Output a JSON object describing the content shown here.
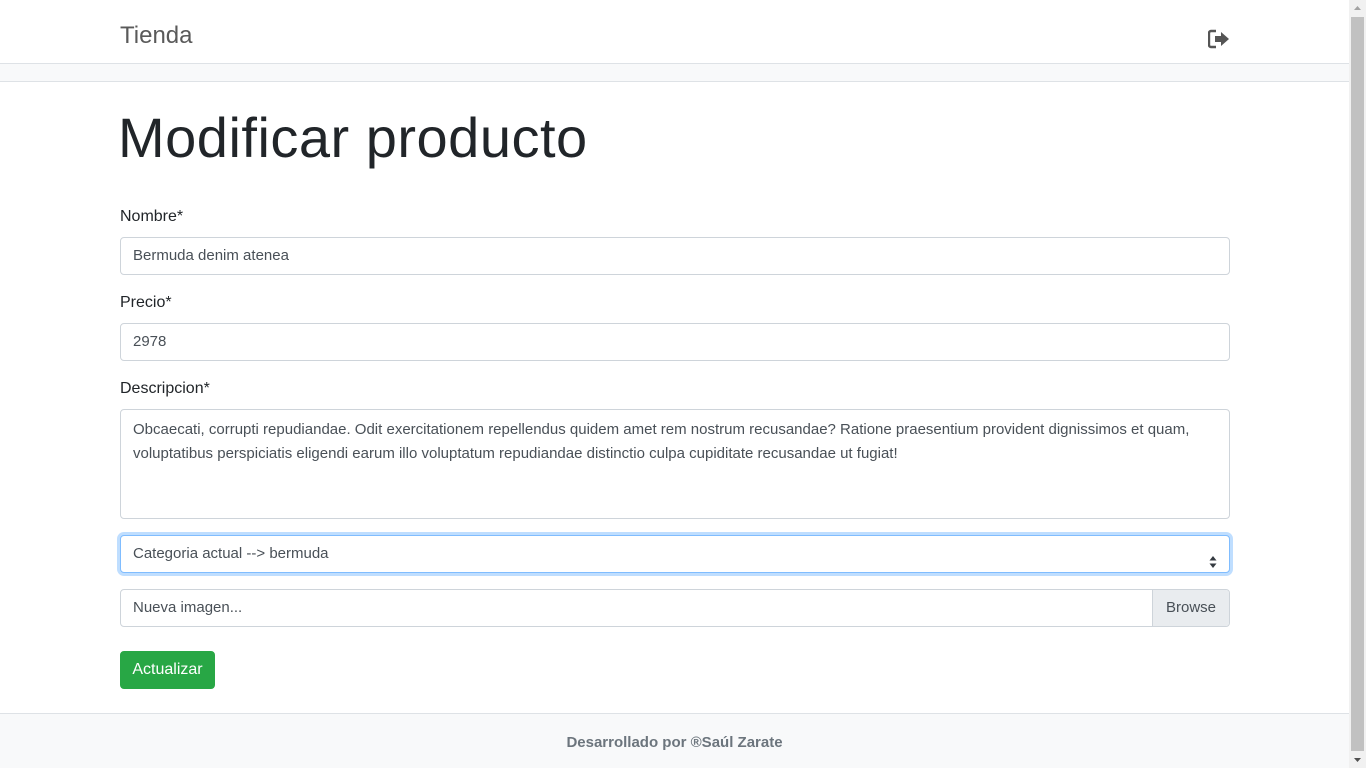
{
  "navbar": {
    "brand": "Tienda",
    "logout_icon": "sign-out-icon"
  },
  "page": {
    "title": "Modificar producto"
  },
  "form": {
    "nombre": {
      "label": "Nombre*",
      "value": "Bermuda denim atenea"
    },
    "precio": {
      "label": "Precio*",
      "value": "2978"
    },
    "descripcion": {
      "label": "Descripcion*",
      "value": "Obcaecati, corrupti repudiandae. Odit exercitationem repellendus quidem amet rem nostrum recusandae? Ratione praesentium provident dignissimos et quam, voluptatibus perspiciatis eligendi earum illo voluptatum repudiandae distinctio culpa cupiditate recusandae ut fugiat!"
    },
    "categoria": {
      "selected": "Categoria actual --> bermuda"
    },
    "imagen": {
      "placeholder": "Nueva imagen...",
      "browse_label": "Browse"
    },
    "submit_label": "Actualizar"
  },
  "footer": {
    "text": "Desarrollado por ®Saúl Zarate"
  },
  "colors": {
    "primary_button": "#28a745",
    "focus_border": "#80bdff",
    "footer_text": "#6c757d"
  }
}
